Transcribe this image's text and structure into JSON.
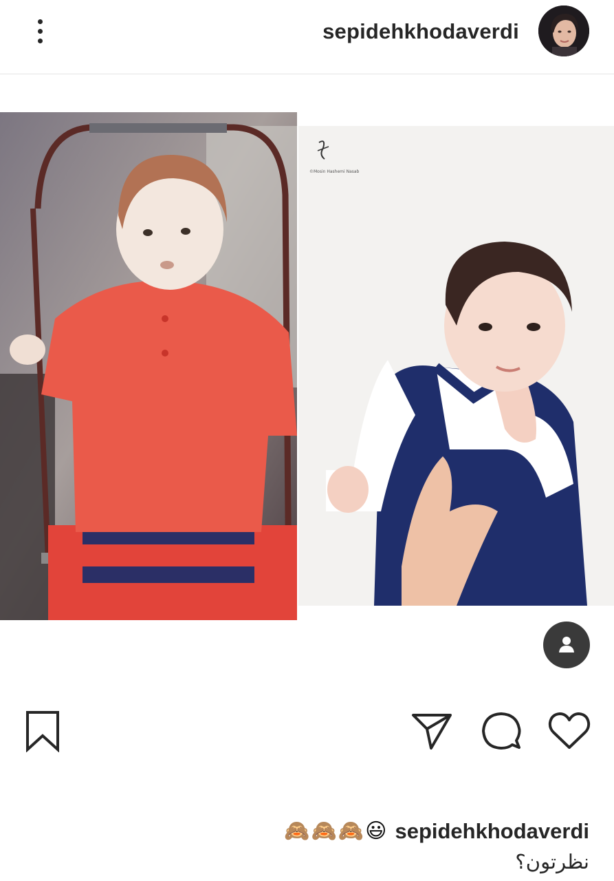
{
  "header": {
    "username": "sepidehkhodaverdi",
    "more_icon": "more-vertical-icon",
    "avatar_icon": "profile-avatar"
  },
  "post": {
    "left_photo": "baby-in-red-sweater-photo",
    "right_photo": "baby-in-navy-suit-photo",
    "watermark_text": "©Mosin Hashemi Nasab",
    "tag_icon": "user-tag-icon"
  },
  "actions": {
    "save_icon": "bookmark-icon",
    "share_icon": "send-icon",
    "comment_icon": "comment-icon",
    "like_icon": "heart-icon"
  },
  "caption": {
    "username": "sepidehkhodaverdi",
    "emojis": "🙈🙈🙈😃",
    "text": "نظرتون؟"
  },
  "colors": {
    "text": "#262626",
    "divider": "#e4e4e4",
    "tag_button": "#3a3a3a"
  }
}
